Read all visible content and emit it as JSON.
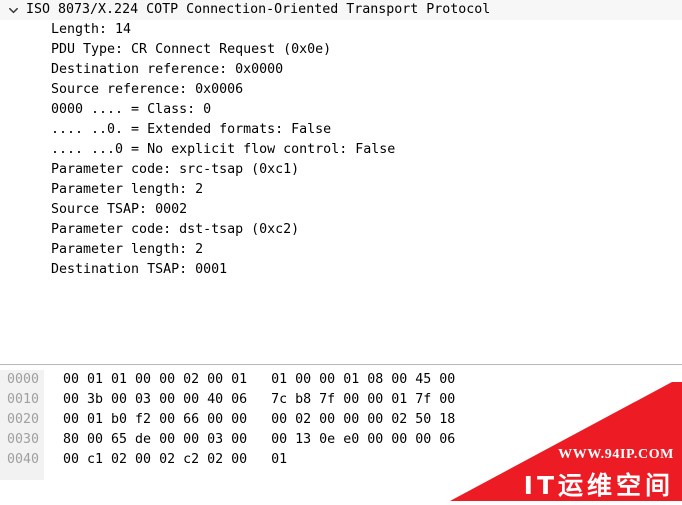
{
  "detail_pane": {
    "root": {
      "expand_icon": "chevron-down-icon",
      "expanded": true,
      "label": "ISO 8073/X.224 COTP Connection-Oriented Transport Protocol"
    },
    "children": [
      {
        "label": "Length: 14"
      },
      {
        "label": "PDU Type: CR Connect Request (0x0e)"
      },
      {
        "label": "Destination reference: 0x0000"
      },
      {
        "label": "Source reference: 0x0006"
      },
      {
        "label": "0000 .... = Class: 0"
      },
      {
        "label": ".... ..0. = Extended formats: False"
      },
      {
        "label": ".... ...0 = No explicit flow control: False"
      },
      {
        "label": "Parameter code: src-tsap (0xc1)"
      },
      {
        "label": "Parameter length: 2"
      },
      {
        "label": "Source TSAP: 0002"
      },
      {
        "label": "Parameter code: dst-tsap (0xc2)"
      },
      {
        "label": "Parameter length: 2"
      },
      {
        "label": "Destination TSAP: 0001"
      }
    ]
  },
  "hex_pane": {
    "rows": [
      {
        "offset": "0000",
        "bytes": "00 01 01 00 00 02 00 01   01 00 00 01 08 00 45 00"
      },
      {
        "offset": "0010",
        "bytes": "00 3b 00 03 00 00 40 06   7c b8 7f 00 00 01 7f 00"
      },
      {
        "offset": "0020",
        "bytes": "00 01 b0 f2 00 66 00 00   00 02 00 00 00 02 50 18"
      },
      {
        "offset": "0030",
        "bytes": "80 00 65 de 00 00 03 00   00 13 0e e0 00 00 00 06"
      },
      {
        "offset": "0040",
        "bytes": "00 c1 02 00 02 c2 02 00   01"
      }
    ]
  },
  "watermark": {
    "url_text": "WWW.94IP.COM",
    "brand_text": "IT运维空间",
    "color": "#ed1b24"
  },
  "colors": {
    "root_row_background": "#f7f7f7",
    "offset_gutter_background": "#f2f2f2",
    "offset_text": "#a0a0a0",
    "body_text": "#000000",
    "divider": "#b8b8b8"
  }
}
